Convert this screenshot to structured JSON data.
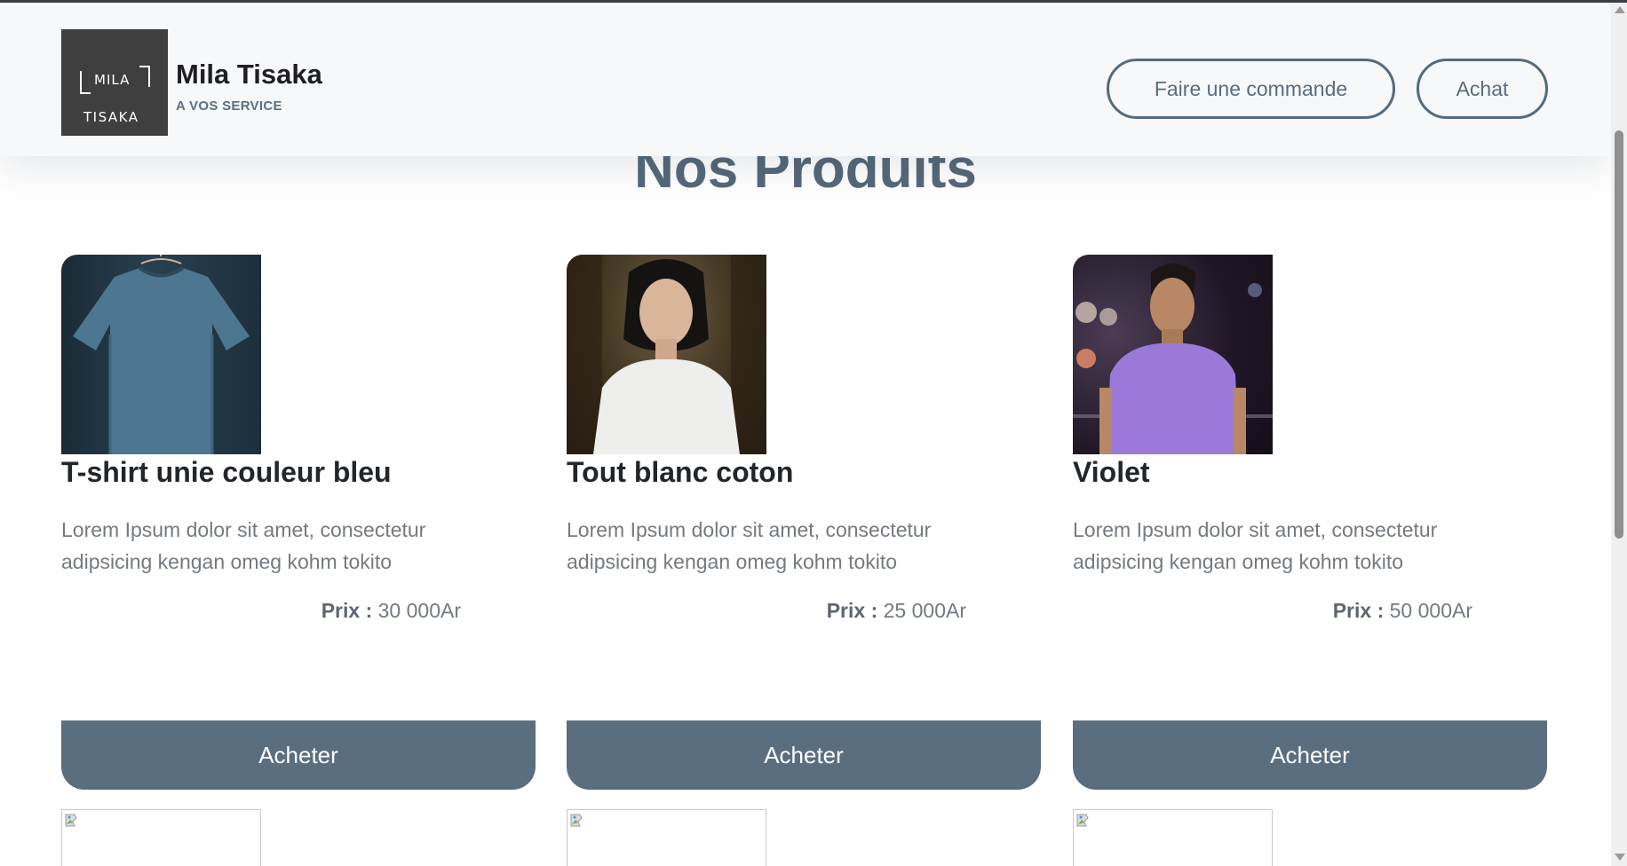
{
  "header": {
    "logo": {
      "line1": "MILA",
      "line2": "TISAKA"
    },
    "brand_name": "Mila Tisaka",
    "tagline": "A VOS SERVICE",
    "order_button": "Faire une commande",
    "buy_button": "Achat"
  },
  "page_title": "Nos Produits",
  "products": [
    {
      "name": "T-shirt unie couleur bleu",
      "description": "Lorem Ipsum dolor sit amet, consectetur adipsicing kengan omeg kohm tokito",
      "price_label": "Prix :",
      "price_value": "30 000Ar",
      "button": "Acheter",
      "icon": "tshirt-image"
    },
    {
      "name": "Tout blanc coton",
      "description": "Lorem Ipsum dolor sit amet, consectetur adipsicing kengan omeg kohm tokito",
      "price_label": "Prix :",
      "price_value": "25 000Ar",
      "button": "Acheter",
      "icon": "woman-white-tshirt-image"
    },
    {
      "name": "Violet",
      "description": "Lorem Ipsum dolor sit amet, consectetur adipsicing kengan omeg kohm tokito",
      "price_label": "Prix :",
      "price_value": "50 000Ar",
      "button": "Acheter",
      "icon": "man-violet-tshirt-image"
    }
  ],
  "colors": {
    "accent": "#5a6e7f",
    "title": "#55687a",
    "header_bg": "#f6f8fa",
    "logo_bg": "#3f3f40"
  }
}
